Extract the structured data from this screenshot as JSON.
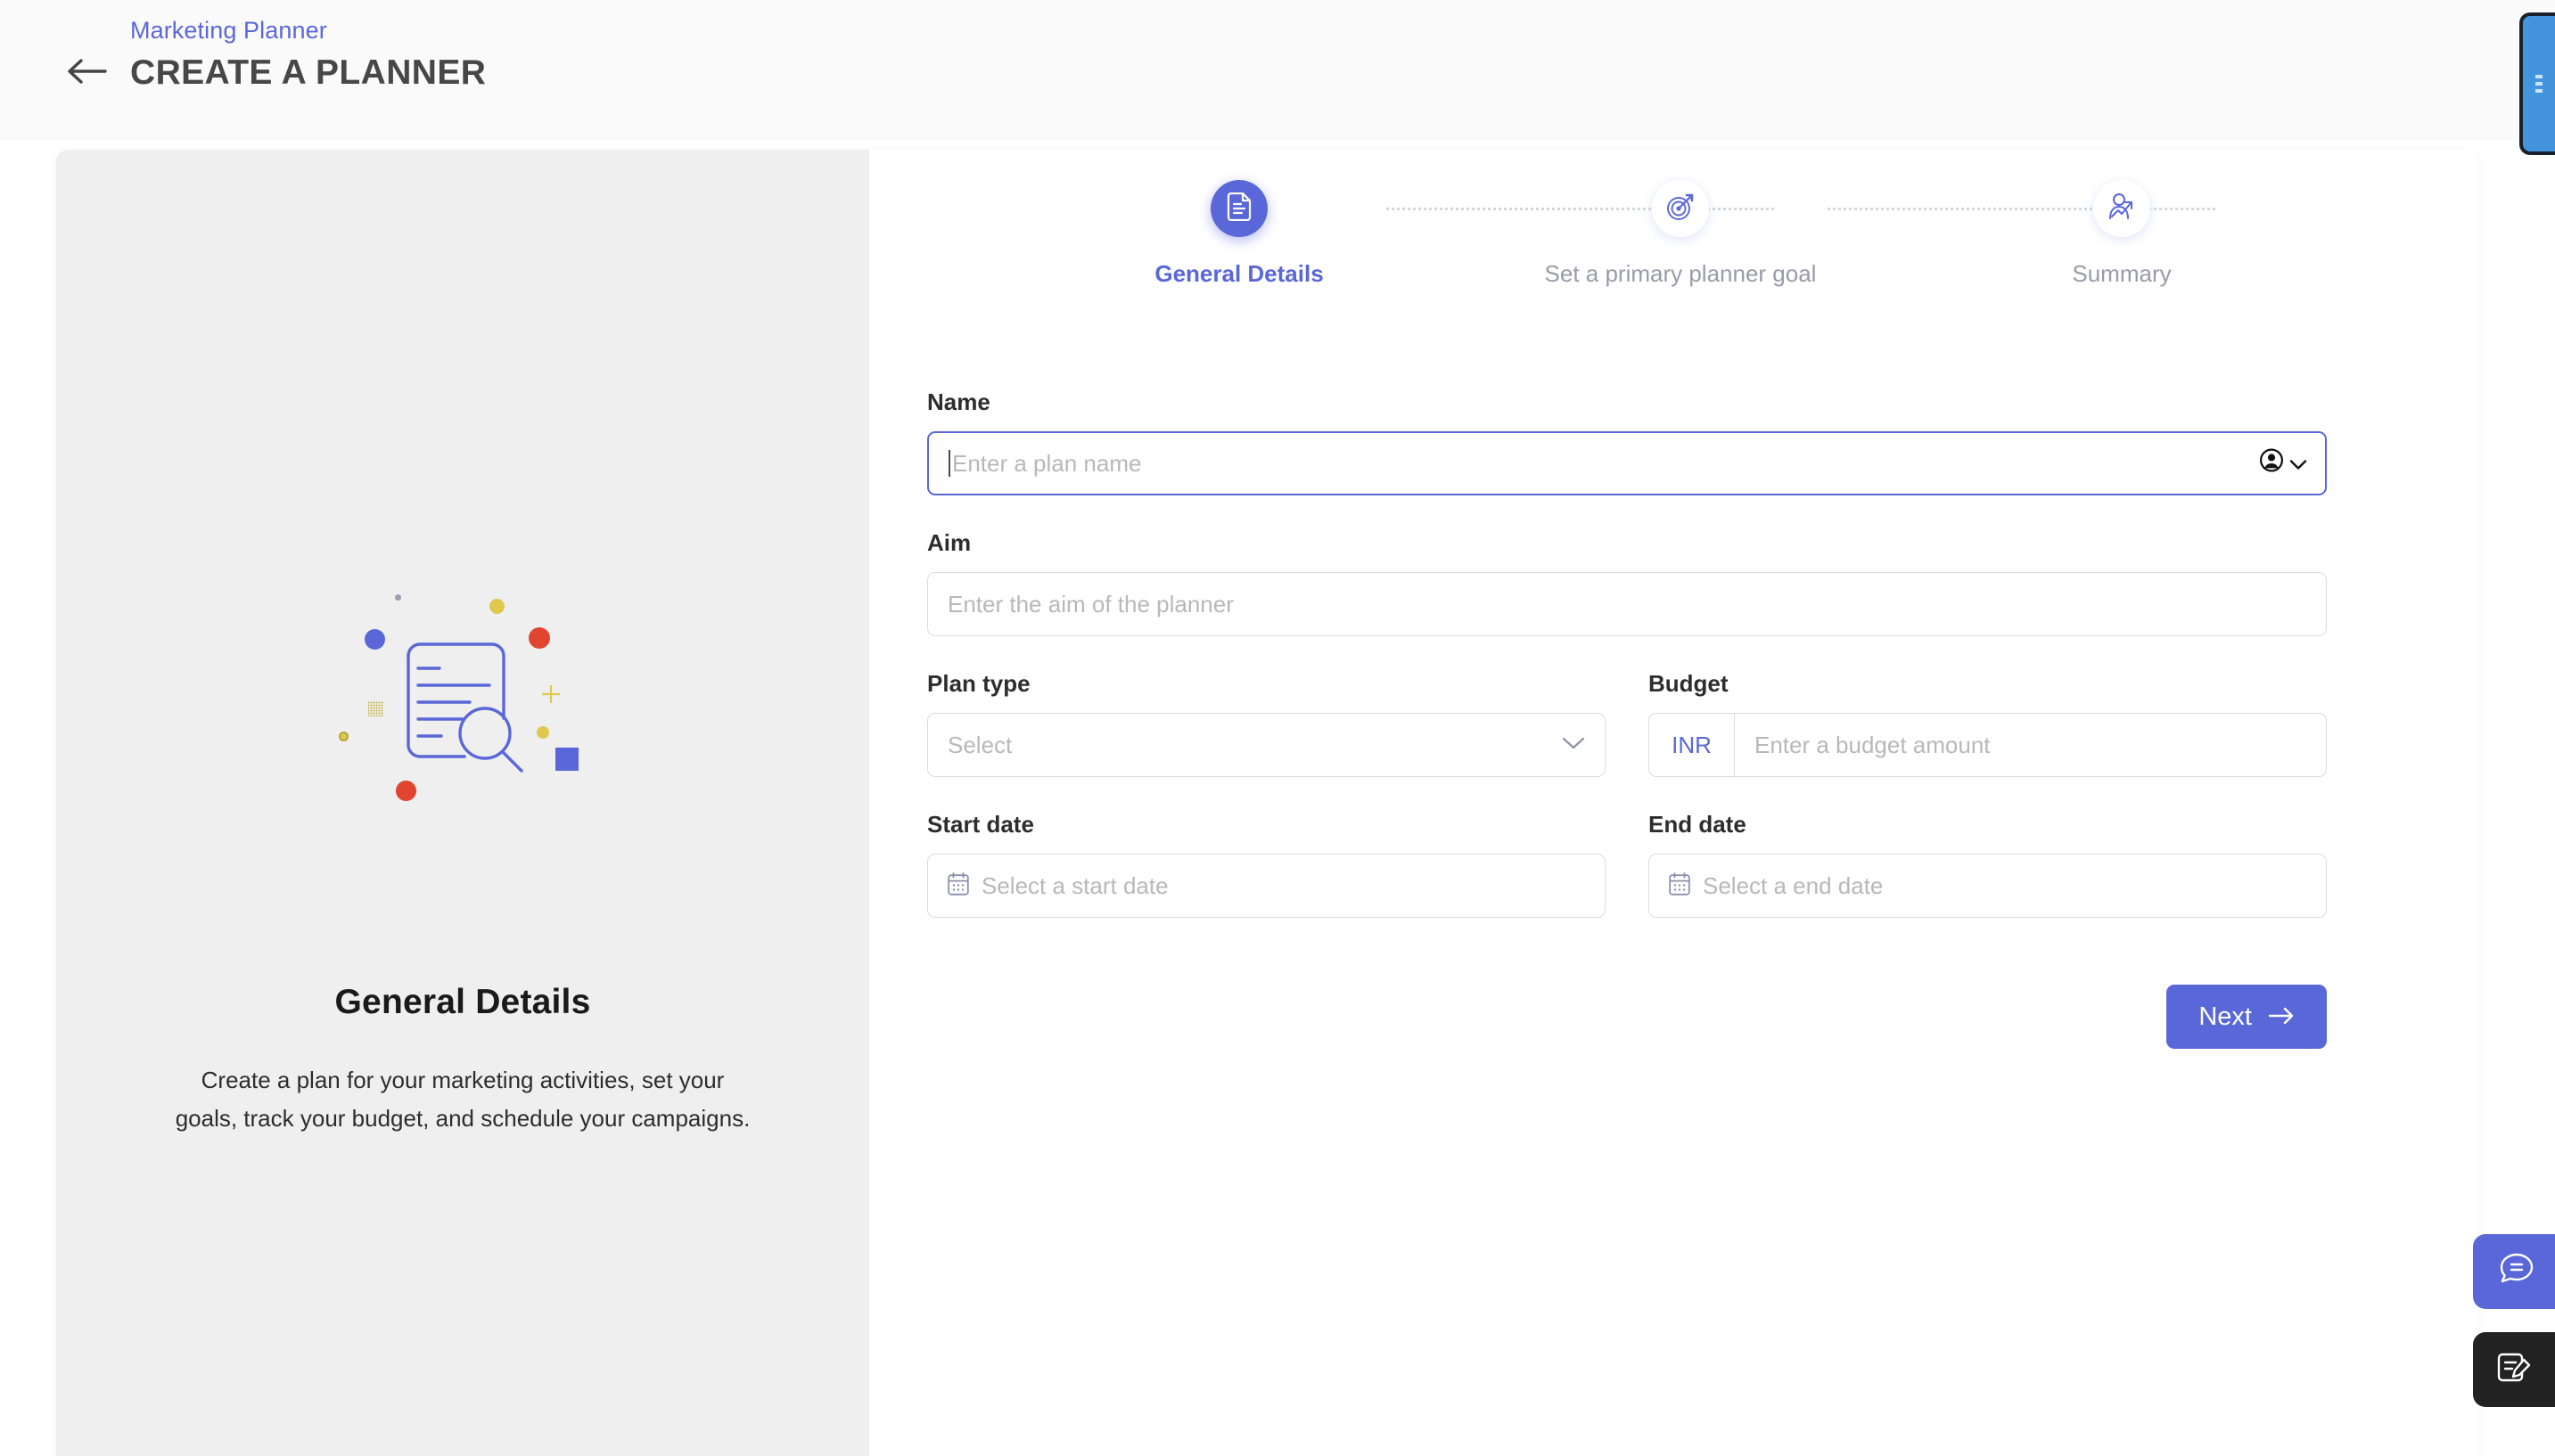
{
  "header": {
    "back_icon": "arrow-left-icon",
    "breadcrumb": "Marketing Planner",
    "title": "CREATE A PLANNER"
  },
  "left_panel": {
    "heading": "General Details",
    "description": "Create a plan for your marketing activities, set your goals, track your budget, and schedule your campaigns.",
    "illustration_icon": "document-search-illustration"
  },
  "stepper": {
    "steps": [
      {
        "label": "General Details",
        "icon": "document-icon",
        "active": true
      },
      {
        "label": "Set a primary planner goal",
        "icon": "target-dart-icon",
        "active": false
      },
      {
        "label": "Summary",
        "icon": "person-growth-chart-icon",
        "active": false
      }
    ]
  },
  "form": {
    "name": {
      "label": "Name",
      "placeholder": "Enter a plan name",
      "value": "",
      "trailing_icon": "user-circle-icon",
      "trailing_chevron": "chevron-down-icon",
      "focused": true
    },
    "aim": {
      "label": "Aim",
      "placeholder": "Enter the aim of the planner",
      "value": ""
    },
    "plan_type": {
      "label": "Plan type",
      "placeholder": "Select",
      "value": "",
      "chevron_icon": "chevron-down-icon"
    },
    "budget": {
      "label": "Budget",
      "currency": "INR",
      "placeholder": "Enter a budget amount",
      "value": ""
    },
    "start_date": {
      "label": "Start date",
      "placeholder": "Select a start date",
      "value": "",
      "icon": "calendar-icon"
    },
    "end_date": {
      "label": "End date",
      "placeholder": "Select a end date",
      "value": "",
      "icon": "calendar-icon"
    },
    "next_button": {
      "label": "Next",
      "icon": "arrow-right-icon"
    }
  },
  "widgets": {
    "chat_icon": "chat-bubble-icon",
    "note_icon": "note-edit-icon",
    "edge_tab_icon": "drawer-handle-icon"
  },
  "colors": {
    "accent": "#5a67d8",
    "panel_bg": "#efefef",
    "header_bg": "#fafafa",
    "border": "#dcdcdc",
    "placeholder": "#b8b8b8",
    "muted_label": "#9a9aa8",
    "edge_tab": "#4394dd",
    "note_fab": "#222222"
  }
}
